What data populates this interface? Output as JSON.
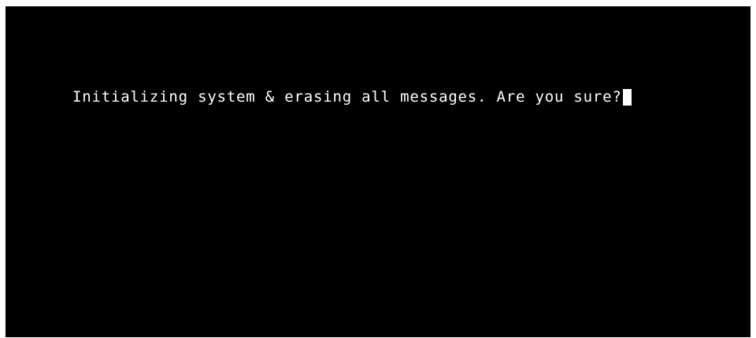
{
  "terminal": {
    "prompt_text": "Initializing system & erasing all messages. Are you sure?",
    "background_color": "#000000",
    "text_color": "#ffffff",
    "cursor_visible": true
  }
}
